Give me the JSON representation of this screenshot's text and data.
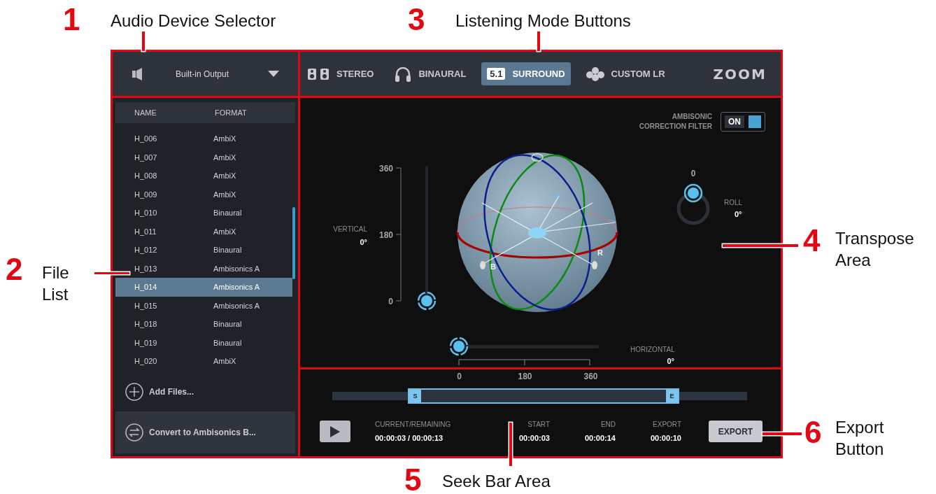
{
  "callouts": [
    {
      "number": "1",
      "label": "Audio Device Selector"
    },
    {
      "number": "3",
      "label": "Listening Mode Buttons"
    },
    {
      "number": "2",
      "label": "File List"
    },
    {
      "number": "4",
      "label": "Transpose Area"
    },
    {
      "number": "5",
      "label": "Seek Bar Area"
    },
    {
      "number": "6",
      "label": "Export Button"
    }
  ],
  "device_selector": {
    "device": "Built-in Output"
  },
  "modes": [
    {
      "kind": "stereo",
      "label": "STEREO",
      "selected": false
    },
    {
      "kind": "binaural",
      "label": "BINAURAL",
      "selected": false
    },
    {
      "kind": "surround",
      "badge": "5.1",
      "label": "SURROUND",
      "selected": true
    },
    {
      "kind": "custom",
      "label": "CUSTOM LR",
      "selected": false
    }
  ],
  "logo": "ZOOM",
  "file_list": {
    "columns": [
      "NAME",
      "FORMAT"
    ],
    "rows": [
      {
        "name": "H_006",
        "format": "AmbiX",
        "selected": false
      },
      {
        "name": "H_007",
        "format": "AmbiX",
        "selected": false
      },
      {
        "name": "H_008",
        "format": "AmbiX",
        "selected": false
      },
      {
        "name": "H_009",
        "format": "AmbiX",
        "selected": false
      },
      {
        "name": "H_010",
        "format": "Binaural",
        "selected": false
      },
      {
        "name": "H_011",
        "format": "AmbiX",
        "selected": false
      },
      {
        "name": "H_012",
        "format": "Binaural",
        "selected": false
      },
      {
        "name": "H_013",
        "format": "Ambisonics A",
        "selected": false
      },
      {
        "name": "H_014",
        "format": "Ambisonics A",
        "selected": true
      },
      {
        "name": "H_015",
        "format": "Ambisonics A",
        "selected": false
      },
      {
        "name": "H_018",
        "format": "Binaural",
        "selected": false
      },
      {
        "name": "H_019",
        "format": "Binaural",
        "selected": false
      },
      {
        "name": "H_020",
        "format": "AmbiX",
        "selected": false
      }
    ],
    "add_files": "Add Files...",
    "convert": "Convert to Ambisonics B..."
  },
  "transpose": {
    "filter": {
      "label": "AMBISONIC CORRECTION FILTER",
      "toggle": "ON",
      "on": true
    },
    "vertical": {
      "label": "VERTICAL",
      "value": "0°",
      "ticks": [
        "360",
        "180",
        "0"
      ],
      "level": 0
    },
    "horizontal": {
      "label": "HORIZONTAL",
      "value": "0°",
      "ticks": [
        "0",
        "180",
        "360"
      ],
      "level": 0
    },
    "roll": {
      "label": "ROLL",
      "value": "0°",
      "tick": "0"
    },
    "sphere_labels": [
      "B",
      "R"
    ]
  },
  "seek": {
    "start_marker": "S",
    "end_marker": "E",
    "readouts": [
      {
        "label": "CURRENT/REMAINING",
        "value": "00:00:03 / 00:00:13"
      },
      {
        "label": "START",
        "value": "00:00:03"
      },
      {
        "label": "END",
        "value": "00:00:14"
      },
      {
        "label": "EXPORT",
        "value": "00:00:10"
      }
    ],
    "export_button": "EXPORT"
  }
}
